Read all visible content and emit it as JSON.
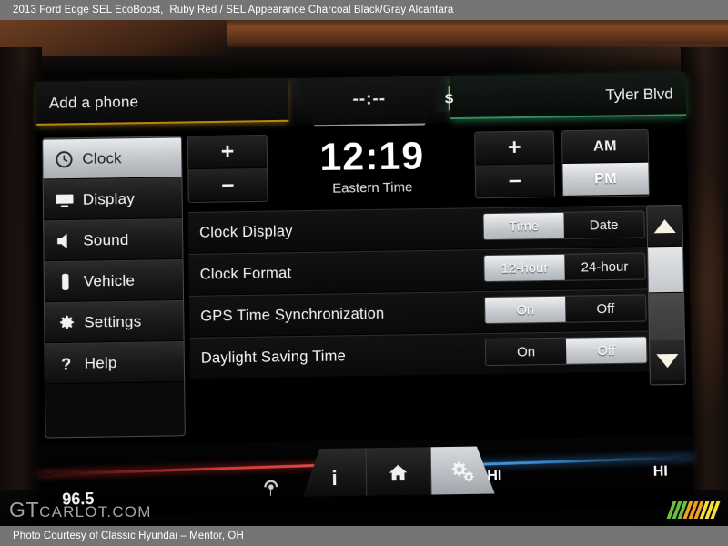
{
  "top_caption": {
    "vehicle": "2013 Ford Edge SEL EcoBoost,",
    "trim": "Ruby Red / SEL Appearance Charcoal Black/Gray Alcantara"
  },
  "bottom_caption": {
    "credit": "Photo Courtesy of Classic Hyundai – Mentor, OH"
  },
  "watermark": {
    "brand_main": "GT",
    "brand_rest": "CARLOT.COM",
    "stripe_colors": [
      "#6abf3b",
      "#6abf3b",
      "#6abf3b",
      "#f0a024",
      "#f0a024",
      "#f0a024",
      "#f2e23a",
      "#f2e23a",
      "#f2e23a"
    ]
  },
  "screen": {
    "header": {
      "phone_label": "Add a phone",
      "center_time": "--:--",
      "compass_letter": "S",
      "street": "Tyler Blvd",
      "left_accent": "#b8860b",
      "right_accent": "#2f8f5c"
    },
    "sidebar": {
      "items": [
        {
          "label": "Clock",
          "icon": "clock-icon",
          "selected": true
        },
        {
          "label": "Display",
          "icon": "display-icon",
          "selected": false
        },
        {
          "label": "Sound",
          "icon": "speaker-icon",
          "selected": false
        },
        {
          "label": "Vehicle",
          "icon": "car-icon",
          "selected": false
        },
        {
          "label": "Settings",
          "icon": "gear-icon",
          "selected": false
        },
        {
          "label": "Help",
          "icon": "question-icon",
          "selected": false
        }
      ]
    },
    "clock_editor": {
      "time": "12:19",
      "timezone": "Eastern Time",
      "plus": "+",
      "minus": "–",
      "am_label": "AM",
      "pm_label": "PM",
      "meridiem_selected": "PM"
    },
    "settings_rows": [
      {
        "label": "Clock Display",
        "options": [
          "Time",
          "Date"
        ],
        "selected": "Time"
      },
      {
        "label": "Clock Format",
        "options": [
          "12-hour",
          "24-hour"
        ],
        "selected": "12-hour"
      },
      {
        "label": "GPS Time Synchronization",
        "options": [
          "On",
          "Off"
        ],
        "selected": "On"
      },
      {
        "label": "Daylight Saving Time",
        "options": [
          "On",
          "Off"
        ],
        "selected": "Off"
      }
    ],
    "scrollbar": {
      "up": "▲",
      "down": "▼",
      "thumb_position": "top"
    },
    "footer": {
      "radio_frequency": "96.5",
      "temp_left": "HI",
      "temp_right": "HI",
      "tabs": [
        {
          "name": "info",
          "glyph": "i",
          "active": false
        },
        {
          "name": "home",
          "glyph": "home",
          "active": false
        },
        {
          "name": "settings",
          "glyph": "gears",
          "active": true
        }
      ],
      "left_accent": "#d43a33",
      "right_accent": "#3b8ed6"
    }
  }
}
